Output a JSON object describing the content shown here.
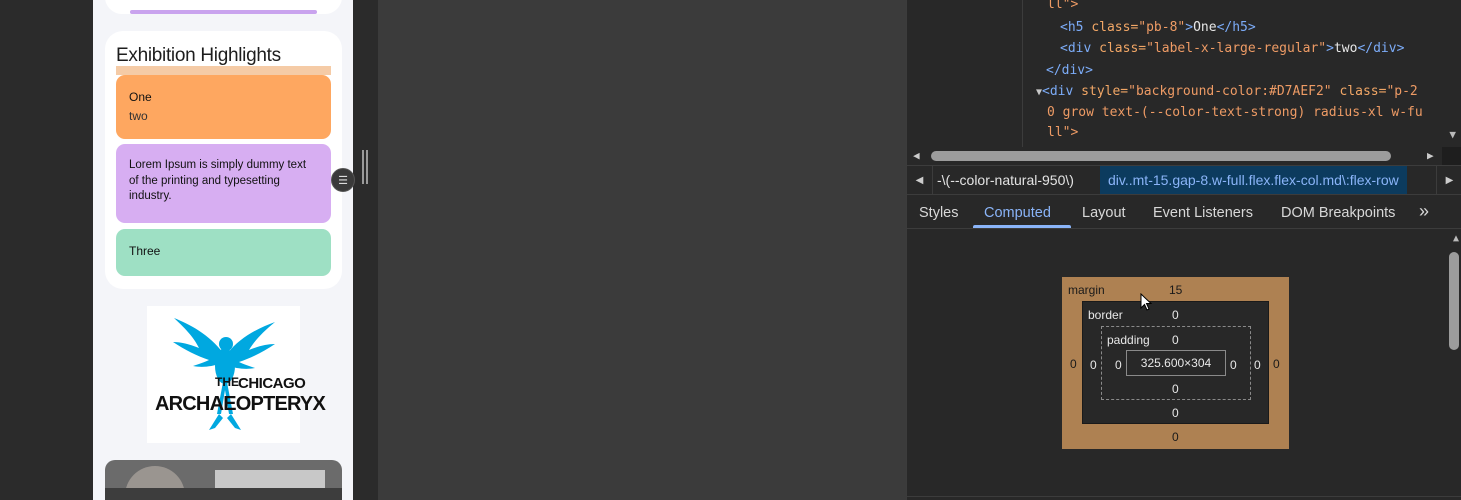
{
  "preview": {
    "card_title": "Exhibition Highlights",
    "tiles": [
      {
        "heading": "One",
        "sub": "two",
        "color": "#fea760"
      },
      {
        "text": "Lorem Ipsum is simply dummy text of the printing and typesetting industry.",
        "color": "#d7aef2"
      },
      {
        "heading": "Three",
        "color": "#9ee0c4"
      }
    ],
    "logo": {
      "line_small_a": "THE",
      "line_small_b": "CHICAGO",
      "line_big": "ARCHAEOPTERYX",
      "color": "#00a8e0"
    }
  },
  "dom_tree": {
    "line1_text": "ll\">",
    "line2": {
      "tag_open": "<h5 ",
      "attr": "class=",
      "val": "\"pb-8\"",
      "close": ">",
      "text": "One",
      "tag_close": "</h5>"
    },
    "line3": {
      "tag_open": "<div ",
      "attr": "class=",
      "val": "\"label-x-large-regular\"",
      "close": ">",
      "text": "two",
      "tag_close": "</div>"
    },
    "line4": "</div>",
    "line5": {
      "tag_open": "<div ",
      "attr1": "style=",
      "val1": "\"background-color:#D7AEF2\"",
      "attr2": " class=",
      "val2": "\"p-2"
    },
    "line6": "0 grow text-(--color-text-strong) radius-xl w-fu",
    "line7": "ll\">"
  },
  "breadcrumb": {
    "item1": "-\\(--color-natural-950\\)",
    "item2": "div..mt-15.gap-8.w-full.flex.flex-col.md\\:flex-row"
  },
  "tabs": [
    {
      "label": "Styles",
      "active": false
    },
    {
      "label": "Computed",
      "active": true
    },
    {
      "label": "Layout",
      "active": false
    },
    {
      "label": "Event Listeners",
      "active": false
    },
    {
      "label": "DOM Breakpoints",
      "active": false
    }
  ],
  "box_model": {
    "margin_label": "margin",
    "margin_top": "15",
    "margin_left": "0",
    "margin_right": "0",
    "margin_bottom": "0",
    "border_label": "border",
    "border_top": "0",
    "border_left": "0",
    "border_right": "0",
    "border_bottom": "0",
    "padding_label": "padding",
    "padding_top": "0",
    "padding_left": "0",
    "padding_right": "0",
    "padding_bottom": "0",
    "content_size": "325.600×304"
  }
}
